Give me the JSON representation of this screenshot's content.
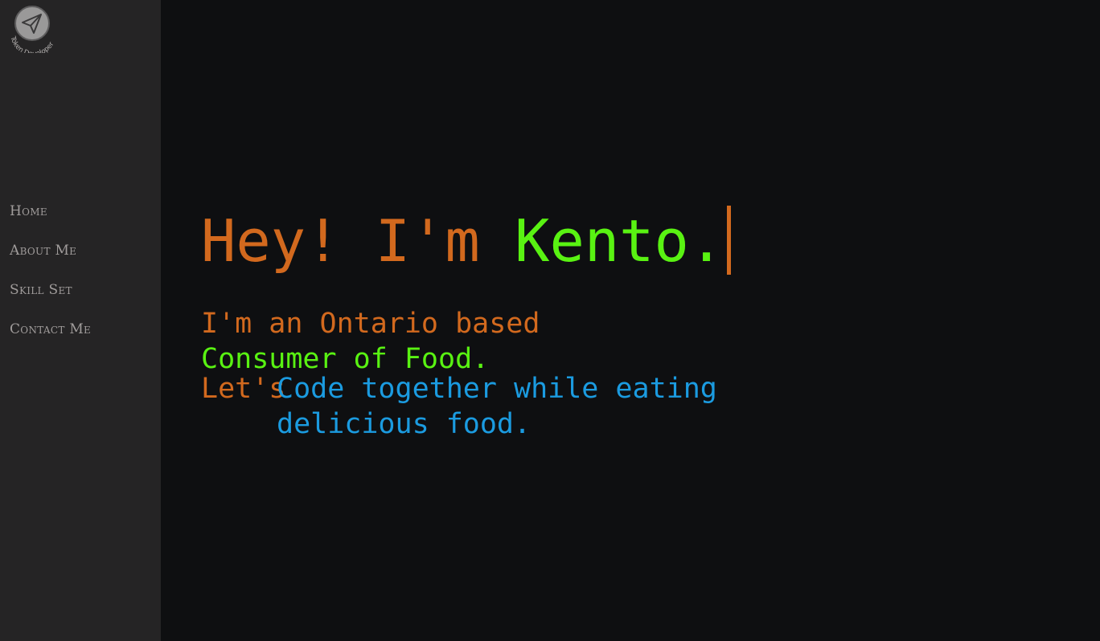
{
  "sidebar": {
    "logo": {
      "icon": "paper-plane-icon",
      "text": "Token Developer"
    },
    "nav": [
      {
        "label": "Home"
      },
      {
        "label": "About Me"
      },
      {
        "label": "Skill Set"
      },
      {
        "label": "Contact Me"
      }
    ]
  },
  "hero": {
    "greeting": "Hey! I'm ",
    "name": "Kento.",
    "line1": "I'm an Ontario based",
    "line2": "Consumer of Food.",
    "lets": "Let's",
    "line3": "Code together while eating",
    "line4": "delicious food."
  },
  "colors": {
    "sidebar_bg": "#252425",
    "main_bg": "#0e0f11",
    "orange": "#d2691e",
    "green": "#59f212",
    "blue": "#1b9be0",
    "nav_text": "#a09c9b"
  }
}
